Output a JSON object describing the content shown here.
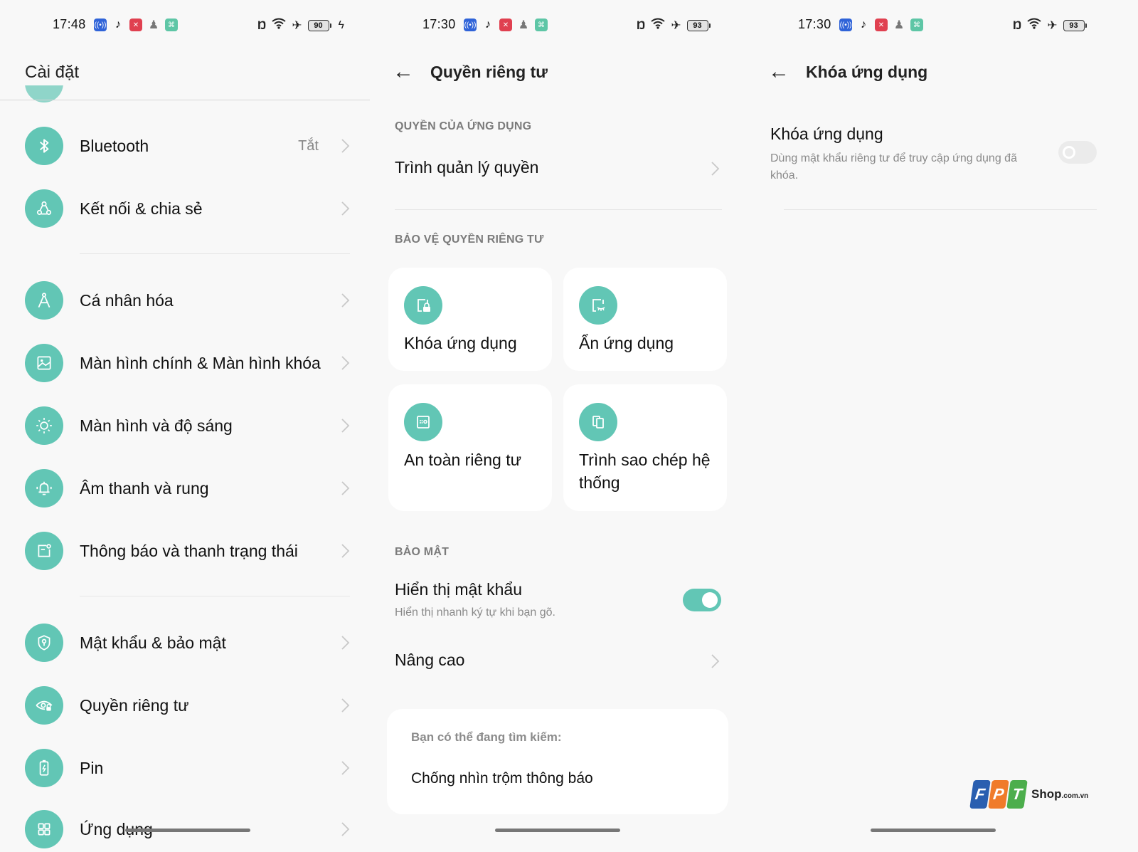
{
  "colors": {
    "accent": "#62c6b5",
    "background": "#f8f8f8",
    "card": "#ffffff",
    "section_label": "#7b7b7b"
  },
  "panels": [
    {
      "status": {
        "time": "17:48",
        "battery": "90",
        "charging": true,
        "notification_icons": [
          "broadcast-app-icon",
          "tiktok-icon",
          "red-app-icon",
          "person-app-icon",
          "green-app-icon"
        ],
        "system_icons": [
          "nfc-icon",
          "wifi-icon",
          "airplane-mode-icon",
          "battery-icon",
          "charging-bolt-icon"
        ]
      },
      "header": {
        "title": "Cài đặt"
      },
      "items": [
        {
          "label": "Bluetooth",
          "value": "Tắt",
          "icon": "bluetooth-icon"
        },
        {
          "label": "Kết nối & chia sẻ",
          "icon": "connection-share-icon"
        },
        {
          "label": "Cá nhân hóa",
          "icon": "compass-personalize-icon"
        },
        {
          "label": "Màn hình chính & Màn hình khóa",
          "icon": "wallpaper-image-icon"
        },
        {
          "label": "Màn hình và độ sáng",
          "icon": "brightness-sun-icon"
        },
        {
          "label": "Âm thanh và rung",
          "icon": "bell-vibrate-icon"
        },
        {
          "label": "Thông báo và thanh trạng thái",
          "icon": "notification-icon"
        },
        {
          "label": "Mật khẩu & bảo mật",
          "icon": "shield-key-icon"
        },
        {
          "label": "Quyền riêng tư",
          "icon": "privacy-eye-icon"
        },
        {
          "label": "Pin",
          "icon": "battery-icon"
        },
        {
          "label": "Ứng dụng",
          "icon": "apps-grid-icon"
        }
      ]
    },
    {
      "status": {
        "time": "17:30",
        "battery": "93",
        "charging": false
      },
      "header": {
        "title": "Quyền riêng tư",
        "back": "back-arrow-icon"
      },
      "sections": {
        "app_permissions": {
          "label": "QUYỀN CỦA ỨNG DỤNG",
          "items": [
            {
              "label": "Trình quản lý quyền"
            }
          ]
        },
        "privacy_protection": {
          "label": "BẢO VỆ QUYỀN RIÊNG TƯ",
          "cards": [
            {
              "label": "Khóa ứng dụng",
              "icon": "app-lock-icon"
            },
            {
              "label": "Ẩn ứng dụng",
              "icon": "app-hide-icon"
            },
            {
              "label": "An toàn riêng tư",
              "icon": "private-safe-icon"
            },
            {
              "label": "Trình sao chép hệ thống",
              "icon": "system-cloner-icon"
            }
          ]
        },
        "security": {
          "label": "BẢO MẬT",
          "show_password": {
            "label": "Hiển thị mật khẩu",
            "sub": "Hiển thị nhanh ký tự khi bạn gõ.",
            "enabled": true
          },
          "advanced": {
            "label": "Nâng cao"
          }
        }
      },
      "suggestions": {
        "title": "Bạn có thể đang tìm kiếm:",
        "items": [
          "Chống nhìn trộm thông báo"
        ]
      }
    },
    {
      "status": {
        "time": "17:30",
        "battery": "93",
        "charging": false
      },
      "header": {
        "title": "Khóa ứng dụng",
        "back": "back-arrow-icon"
      },
      "app_lock": {
        "label": "Khóa ứng dụng",
        "sub": "Dùng mật khẩu riêng tư để truy cập ứng dụng đã khóa.",
        "enabled": false
      }
    }
  ],
  "watermark": {
    "brand_letters": [
      "F",
      "P",
      "T"
    ],
    "shop": "Shop",
    "domain": ".com.vn"
  }
}
